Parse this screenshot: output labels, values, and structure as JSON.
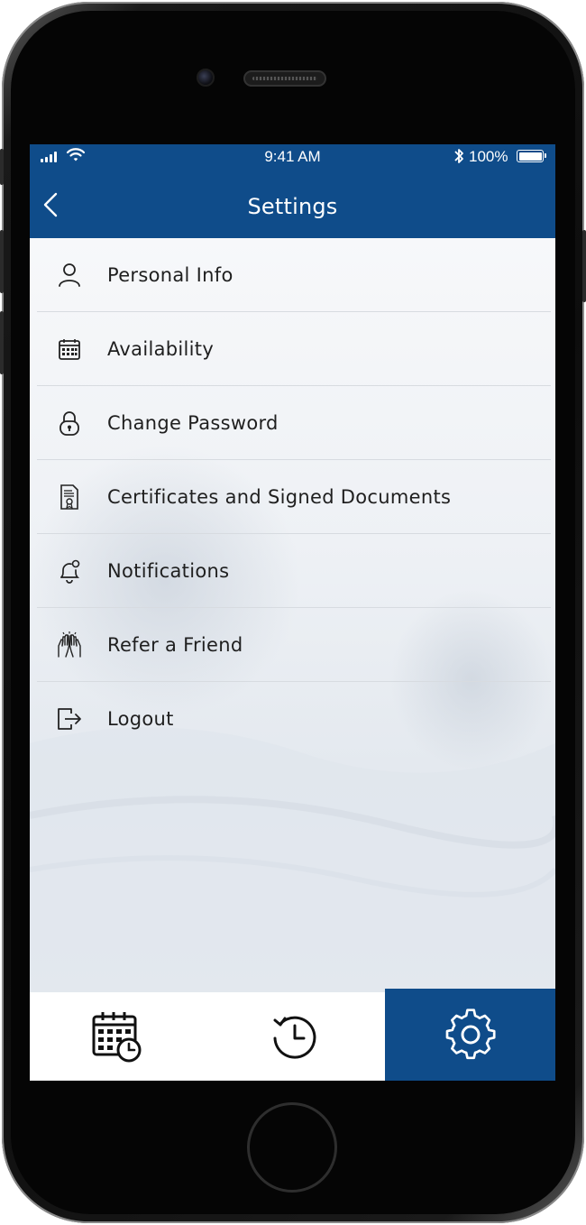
{
  "status_bar": {
    "time": "9:41 AM",
    "battery_percent": "100%",
    "battery_level": 1.0,
    "icons": [
      "signal-icon",
      "wifi-icon",
      "bluetooth-icon",
      "battery-icon"
    ]
  },
  "nav": {
    "title": "Settings",
    "back_icon": "chevron-left-icon"
  },
  "menu": {
    "items": [
      {
        "label": "Personal Info",
        "icon": "user-icon"
      },
      {
        "label": "Availability",
        "icon": "calendar-icon"
      },
      {
        "label": "Change Password",
        "icon": "lock-icon"
      },
      {
        "label": "Certificates and Signed Documents",
        "icon": "certificate-icon"
      },
      {
        "label": "Notifications",
        "icon": "bell-icon"
      },
      {
        "label": "Refer a Friend",
        "icon": "hands-icon"
      },
      {
        "label": "Logout",
        "icon": "logout-icon"
      }
    ]
  },
  "tab_bar": {
    "tabs": [
      {
        "icon": "calendar-clock-icon",
        "active": false
      },
      {
        "icon": "history-icon",
        "active": false
      },
      {
        "icon": "gear-icon",
        "active": true
      }
    ]
  },
  "colors": {
    "brand_blue": "#0f4c8a",
    "text": "#1f1f1f",
    "divider": "#d7dbe0"
  }
}
